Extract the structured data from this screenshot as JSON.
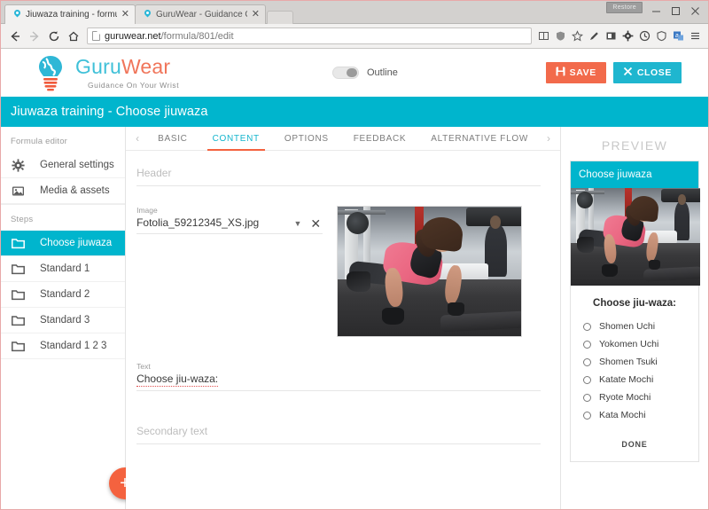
{
  "browser": {
    "tabs": [
      {
        "title": "Jiuwaza training - formula",
        "favicon": "pin-icon",
        "active": true
      },
      {
        "title": "GuruWear - Guidance On",
        "favicon": "pin-icon",
        "active": false
      }
    ],
    "new_tab_label": "",
    "window_tooltip": "Restore",
    "window_buttons": {
      "minimize": "minimize-icon",
      "maximize": "maximize-icon",
      "close": "close-icon"
    },
    "nav": {
      "back": "back-arrow-icon",
      "forward": "forward-arrow-icon",
      "reload": "reload-icon",
      "home": "home-icon"
    },
    "url_host": "guruwear.net",
    "url_path": "/formula/801/edit",
    "toolbar_icons": [
      "reader-icon",
      "shield-icon",
      "bookmark-star-icon",
      "pencil-icon",
      "screenshot-icon",
      "gear-icon",
      "clock-icon",
      "security-shield-icon",
      "translate-icon",
      "menu-icon"
    ]
  },
  "app": {
    "logo": {
      "word_part1": "Guru",
      "word_part2": "Wear",
      "tagline": "Guidance On Your Wrist",
      "mark": "lightbulb-globe-icon"
    },
    "outline_toggle": {
      "label": "Outline",
      "state": "off"
    },
    "actions": {
      "save": {
        "label": "SAVE",
        "icon": "save-disk-icon",
        "color": "#f26a4b"
      },
      "close": {
        "label": "CLOSE",
        "icon": "close-x-icon",
        "color": "#1fb6cf"
      }
    },
    "title_bar": {
      "text": "Jiuwaza training - Choose jiuwaza",
      "color": "#00b5cd"
    }
  },
  "sidebar": {
    "section_editor": "Formula editor",
    "items": [
      {
        "label": "General settings",
        "icon": "gear-icon"
      },
      {
        "label": "Media & assets",
        "icon": "image-icon"
      }
    ],
    "section_steps": "Steps",
    "steps": [
      {
        "label": "Choose jiuwaza",
        "icon": "folder-icon",
        "active": true
      },
      {
        "label": "Standard 1",
        "icon": "folder-icon",
        "active": false
      },
      {
        "label": "Standard 2",
        "icon": "folder-icon",
        "active": false
      },
      {
        "label": "Standard 3",
        "icon": "folder-icon",
        "active": false
      },
      {
        "label": "Standard 1 2 3",
        "icon": "folder-icon",
        "active": false
      }
    ],
    "add_button": {
      "icon": "plus-icon",
      "label": "+",
      "color": "#f4623f"
    }
  },
  "editor": {
    "tabs": [
      {
        "label": "BASIC",
        "active": false
      },
      {
        "label": "CONTENT",
        "active": true
      },
      {
        "label": "OPTIONS",
        "active": false
      },
      {
        "label": "FEEDBACK",
        "active": false
      },
      {
        "label": "ALTERNATIVE FLOW",
        "active": false
      }
    ],
    "tab_prev_icon": "chevron-left-icon",
    "tab_next_icon": "chevron-right-icon",
    "fields": {
      "header": {
        "label": "",
        "placeholder": "Header",
        "value": ""
      },
      "image": {
        "label": "Image",
        "value": "Fotolia_59212345_XS.jpg",
        "dropdown_icon": "caret-down-icon",
        "clear_icon": "clear-x-icon",
        "thumbnail": "gym-pushup-photo"
      },
      "text": {
        "label": "Text",
        "value": "Choose jiu-waza:",
        "placeholder": ""
      },
      "secondary_text": {
        "label": "",
        "placeholder": "Secondary text",
        "value": ""
      }
    }
  },
  "preview": {
    "title": "PREVIEW",
    "card_header": "Choose jiuwaza",
    "image": "gym-pushup-photo",
    "question": "Choose jiu-waza:",
    "options": [
      "Shomen Uchi",
      "Yokomen Uchi",
      "Shomen Tsuki",
      "Katate Mochi",
      "Ryote Mochi",
      "Kata Mochi"
    ],
    "done_label": "DONE"
  },
  "colors": {
    "cyan": "#00b5cd",
    "orange": "#f4623f",
    "save_orange": "#f26a4b"
  }
}
